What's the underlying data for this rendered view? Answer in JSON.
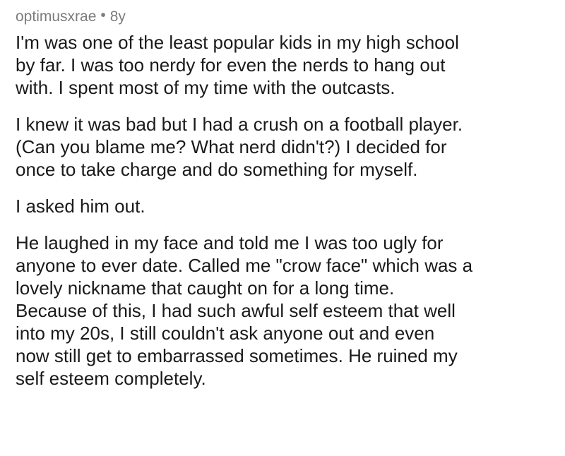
{
  "comment": {
    "username": "optimusxrae",
    "separator": "•",
    "age": "8y",
    "paragraphs": [
      "I'm was one of the least popular kids in my high school\nby far. I was too nerdy for even the nerds to hang out\nwith. I spent most of my time with the outcasts.",
      "I knew it was bad but I had a crush on a football player.\n(Can you blame me? What nerd didn't?) I decided for\nonce to take charge and do something for myself.",
      "I asked him out.",
      "He laughed in my face and told me I was too ugly for\nanyone to ever date. Called me \"crow face\" which was a\nlovely nickname that caught on for a long time.\nBecause of this, I had such awful self esteem that well\ninto my 20s, I still couldn't ask anyone out and even\nnow still get to embarrassed sometimes. He ruined my\nself esteem completely."
    ]
  },
  "colors": {
    "meta_text": "#7c7c7c",
    "body_text": "#1a1a1b",
    "background": "#ffffff"
  }
}
